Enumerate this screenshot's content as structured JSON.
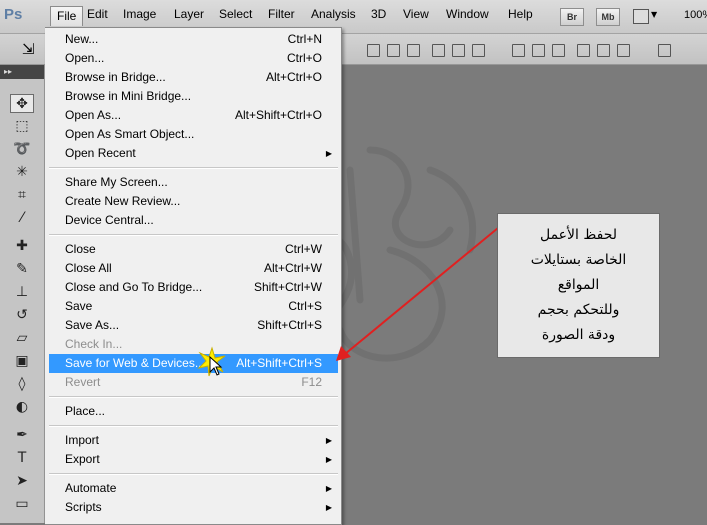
{
  "app": {
    "logo": "Ps"
  },
  "menubar": {
    "items": [
      "File",
      "Edit",
      "Image",
      "Layer",
      "Select",
      "Filter",
      "Analysis",
      "3D",
      "View",
      "Window",
      "Help"
    ],
    "active": "File",
    "bridge_btn": "Br",
    "minibridge_btn": "Mb",
    "zoom": "100%"
  },
  "file_menu": {
    "groups": [
      [
        {
          "label": "New...",
          "shortcut": "Ctrl+N"
        },
        {
          "label": "Open...",
          "shortcut": "Ctrl+O"
        },
        {
          "label": "Browse in Bridge...",
          "shortcut": "Alt+Ctrl+O"
        },
        {
          "label": "Browse in Mini Bridge...",
          "shortcut": ""
        },
        {
          "label": "Open As...",
          "shortcut": "Alt+Shift+Ctrl+O"
        },
        {
          "label": "Open As Smart Object...",
          "shortcut": ""
        },
        {
          "label": "Open Recent",
          "shortcut": "",
          "submenu": true
        }
      ],
      [
        {
          "label": "Share My Screen...",
          "shortcut": ""
        },
        {
          "label": "Create New Review...",
          "shortcut": ""
        },
        {
          "label": "Device Central...",
          "shortcut": ""
        }
      ],
      [
        {
          "label": "Close",
          "shortcut": "Ctrl+W"
        },
        {
          "label": "Close All",
          "shortcut": "Alt+Ctrl+W"
        },
        {
          "label": "Close and Go To Bridge...",
          "shortcut": "Shift+Ctrl+W"
        },
        {
          "label": "Save",
          "shortcut": "Ctrl+S"
        },
        {
          "label": "Save As...",
          "shortcut": "Shift+Ctrl+S"
        },
        {
          "label": "Check In...",
          "shortcut": "",
          "disabled": true
        },
        {
          "label": "Save for Web & Devices...",
          "shortcut": "Alt+Shift+Ctrl+S",
          "highlighted": true
        },
        {
          "label": "Revert",
          "shortcut": "F12",
          "disabled": true
        }
      ],
      [
        {
          "label": "Place...",
          "shortcut": ""
        }
      ],
      [
        {
          "label": "Import",
          "shortcut": "",
          "submenu": true
        },
        {
          "label": "Export",
          "shortcut": "",
          "submenu": true
        }
      ],
      [
        {
          "label": "Automate",
          "shortcut": "",
          "submenu": true
        },
        {
          "label": "Scripts",
          "shortcut": "",
          "submenu": true
        }
      ]
    ]
  },
  "callout": {
    "lines": [
      "لحفظ الأعمل",
      "الخاصة بستايلات",
      "المواقع",
      "وللتحكم بحجم",
      "ودقة الصورة"
    ]
  },
  "colors": {
    "highlight": "#3399ff",
    "arrow": "#e02020",
    "canvas": "#7b7b7b"
  }
}
